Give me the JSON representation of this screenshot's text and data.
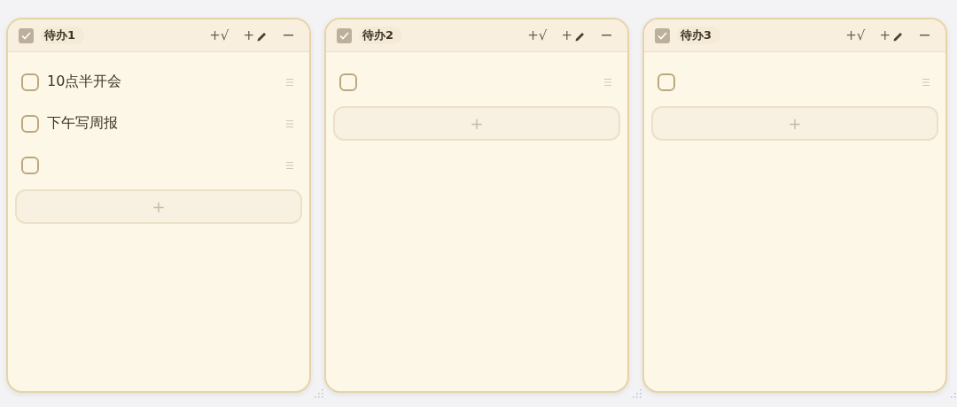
{
  "lists": [
    {
      "title": "待办1",
      "checked": true,
      "actions": [
        {
          "kind": "check",
          "label": "+√"
        },
        {
          "kind": "pencil",
          "label": "+"
        }
      ],
      "items": [
        {
          "text": "10点半开会",
          "checked": false
        },
        {
          "text": "下午写周报",
          "checked": false
        },
        {
          "checked": false
        }
      ],
      "add_label": "+"
    },
    {
      "title": "待办2",
      "checked": true,
      "actions": [
        {
          "kind": "check",
          "label": "+√"
        },
        {
          "kind": "pencil",
          "label": "+"
        }
      ],
      "items": [
        {
          "checked": false
        }
      ],
      "add_label": "+"
    },
    {
      "title": "待办3",
      "checked": true,
      "actions": [
        {
          "kind": "check",
          "label": "+√"
        },
        {
          "kind": "pencil",
          "label": "+"
        }
      ],
      "items": [
        {
          "checked": false
        }
      ],
      "add_label": "+"
    }
  ]
}
